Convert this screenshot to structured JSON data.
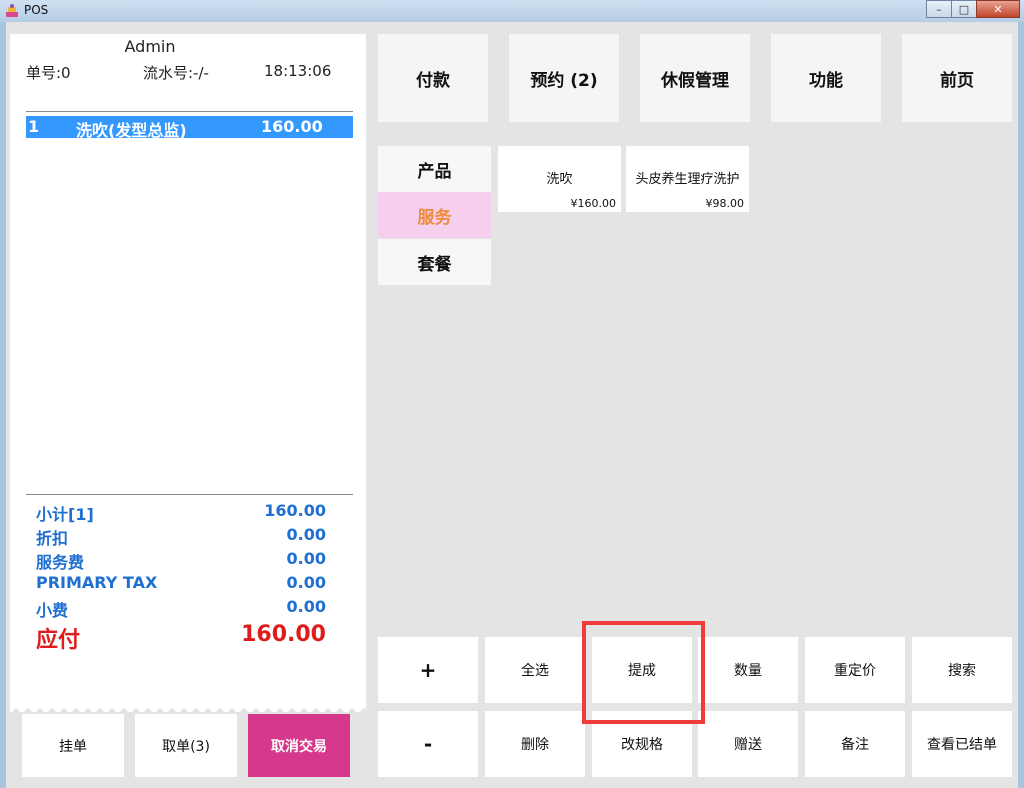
{
  "window": {
    "title": "POS",
    "minimize": "–",
    "maximize": "□",
    "close": "✕"
  },
  "receipt": {
    "user": "Admin",
    "order_no_label": "单号:0",
    "serial_label": "流水号:-/-",
    "time": "18:13:06",
    "items": [
      {
        "index": "1",
        "name": "洗吹(发型总监)",
        "amount": "160.00"
      }
    ],
    "summary": [
      {
        "label": "小计[1]",
        "value": "160.00"
      },
      {
        "label": "折扣",
        "value": "0.00"
      },
      {
        "label": "服务费",
        "value": "0.00"
      },
      {
        "label": "PRIMARY TAX",
        "value": "0.00"
      },
      {
        "label": "小费",
        "value": "0.00"
      }
    ],
    "total": {
      "label": "应付",
      "value": "160.00"
    }
  },
  "bottom_buttons": {
    "hold": "挂单",
    "retrieve": "取单(3)",
    "cancel": "取消交易"
  },
  "top_buttons": {
    "pay": "付款",
    "reserve": "预约 (2)",
    "leave": "休假管理",
    "function": "功能",
    "home": "前页"
  },
  "categories": {
    "product": "产品",
    "service": "服务",
    "package": "套餐"
  },
  "tiles": [
    {
      "name": "洗吹",
      "price": "¥160.00"
    },
    {
      "name": "头皮养生理疗洗护",
      "price": "¥98.00"
    }
  ],
  "actions": {
    "plus": "+",
    "select_all": "全选",
    "commission": "提成",
    "quantity": "数量",
    "reprice": "重定价",
    "search": "搜索",
    "minus": "-",
    "delete": "删除",
    "change_spec": "改规格",
    "gift": "赠送",
    "remark": "备注",
    "view_settled": "查看已结单"
  },
  "colors": {
    "selected_row": "#3399ff",
    "summary_text": "#1f6fd1",
    "total_text": "#e01b1b",
    "cancel_button": "#d6398b",
    "active_category": "#f6cfee",
    "highlight": "#ef3b3b"
  }
}
